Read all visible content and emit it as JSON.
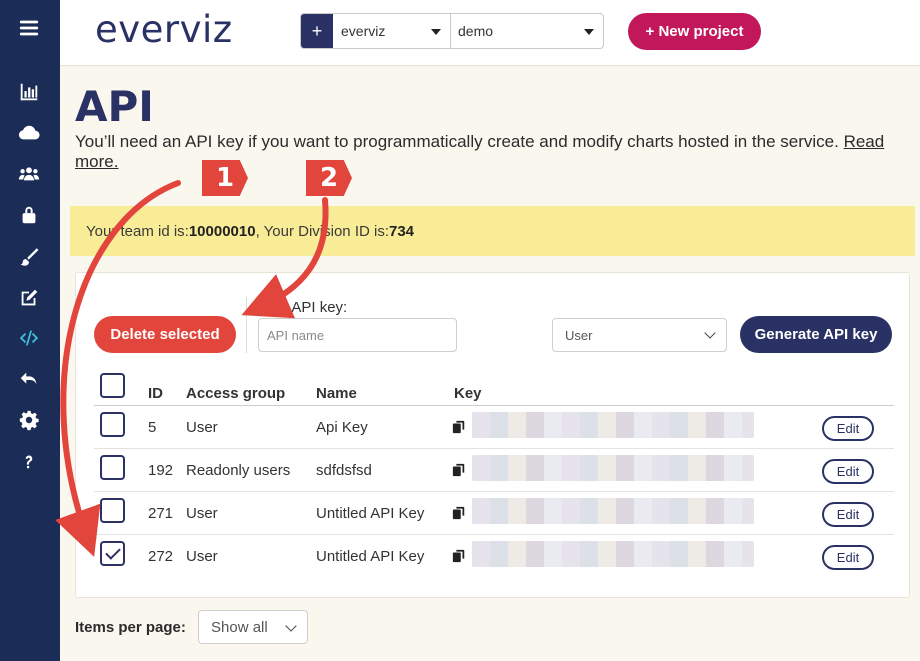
{
  "brand": {
    "logo_text": "everviz"
  },
  "topbar": {
    "add_symbol": "+",
    "team_select": "everviz",
    "project_select": "demo",
    "new_project_label": "+ New project"
  },
  "page": {
    "title": "API",
    "intro_text": "You’ll need an API key if you want to programmatically create and modify charts hosted in the service.",
    "read_more_part1": "Read",
    "read_more_part2": "more."
  },
  "notice": {
    "team_prefix": "Your team id is: ",
    "team_id": "10000010",
    "division_prefix": ", Your Division ID is: ",
    "division_id": "734"
  },
  "toolbar": {
    "delete_label": "Delete selected",
    "new_key_label": "New API key:",
    "api_name_placeholder": "API name",
    "access_group_value": "User",
    "generate_label": "Generate API key"
  },
  "table": {
    "headers": {
      "id": "ID",
      "access_group": "Access group",
      "name": "Name",
      "key": "Key"
    },
    "rows": [
      {
        "id": "5",
        "access_group": "User",
        "name": "Api Key",
        "checked": false,
        "edit": "Edit"
      },
      {
        "id": "192",
        "access_group": "Readonly users",
        "name": "sdfdsfsd",
        "checked": false,
        "edit": "Edit"
      },
      {
        "id": "271",
        "access_group": "User",
        "name": "Untitled API Key",
        "checked": false,
        "edit": "Edit"
      },
      {
        "id": "272",
        "access_group": "User",
        "name": "Untitled API Key",
        "checked": true,
        "edit": "Edit"
      }
    ]
  },
  "footer": {
    "items_per_page_label": "Items per page:",
    "items_per_page_value": "Show all"
  },
  "annotations": {
    "step1": "1",
    "step2": "2",
    "color": "#e2453c"
  },
  "colors": {
    "sidebar": "#1b2c57",
    "accent": "#2a3265",
    "danger": "#e2453c",
    "brand": "#c2185b",
    "notice": "#f9ec97"
  },
  "sidebar": {
    "icons": [
      "menu-icon",
      "chart-icon",
      "cloud-icon",
      "users-icon",
      "lock-icon",
      "brush-icon",
      "edit-icon",
      "code-icon",
      "undo-icon",
      "gear-icon",
      "help-icon"
    ]
  }
}
